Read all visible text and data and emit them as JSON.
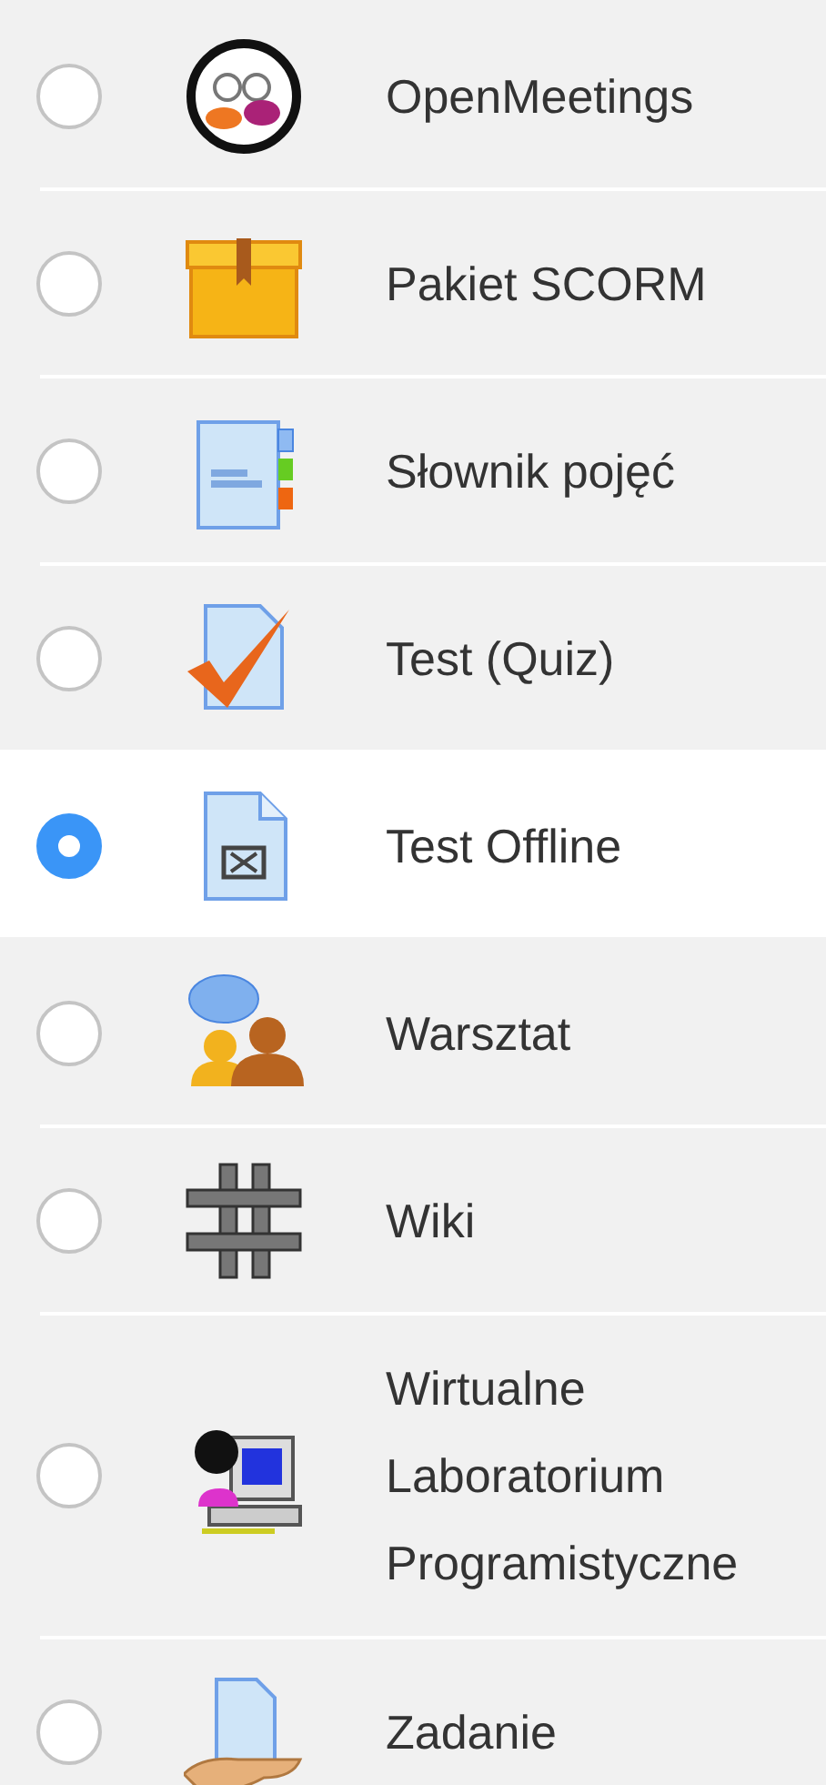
{
  "options": [
    {
      "label": "OpenMeetings",
      "selected": false
    },
    {
      "label": "Pakiet SCORM",
      "selected": false
    },
    {
      "label": "Słownik pojęć",
      "selected": false
    },
    {
      "label": "Test (Quiz)",
      "selected": false
    },
    {
      "label": "Test Offline",
      "selected": true
    },
    {
      "label": "Warsztat",
      "selected": false
    },
    {
      "label": "Wiki",
      "selected": false
    },
    {
      "label": "Wirtualne Laboratorium Programistyczne",
      "selected": false
    },
    {
      "label": "Zadanie",
      "selected": false
    }
  ]
}
